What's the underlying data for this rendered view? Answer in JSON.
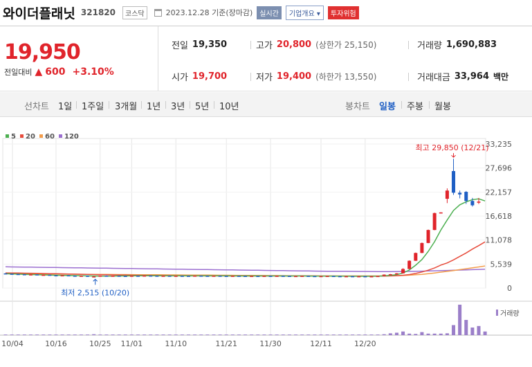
{
  "header": {
    "name": "와이더플래닛",
    "code": "321820",
    "market": "코스닥",
    "date": "2023.12.28 기준(장마감)",
    "live": "실시간",
    "company_info": "기업개요",
    "risk": "투자위험"
  },
  "quote": {
    "price": "19,950",
    "change_label": "전일대비",
    "change": "600",
    "change_pct": "+3.10%",
    "prev_close_label": "전일",
    "prev_close": "19,350",
    "high_label": "고가",
    "high": "20,800",
    "upper_limit": "(상한가 25,150)",
    "volume_label": "거래량",
    "volume": "1,690,883",
    "open_label": "시가",
    "open": "19,700",
    "low_label": "저가",
    "low": "19,400",
    "lower_limit": "(하한가 13,550)",
    "amount_label": "거래대금",
    "amount": "33,964",
    "amount_unit": "백만"
  },
  "toolbar": {
    "line_chart": "선차트",
    "periods": [
      "1일",
      "1주일",
      "3개월",
      "1년",
      "3년",
      "5년",
      "10년"
    ],
    "candle_chart": "봉차트",
    "candle_periods": [
      "일봉",
      "주봉",
      "월봉"
    ]
  },
  "colors": {
    "up": "#e0242b",
    "down": "#1f5fc4",
    "ma5": "#4caf50",
    "ma20": "#e74c3c",
    "ma60": "#f39c4a",
    "ma120": "#9b6fd0",
    "volume": "#9b7fc9"
  },
  "chart_data": {
    "type": "candlestick",
    "legend": [
      "5",
      "20",
      "60",
      "120"
    ],
    "x_tick_labels": [
      "10/04",
      "10/16",
      "10/25",
      "11/01",
      "11/10",
      "11/21",
      "11/30",
      "12/11",
      "12/20"
    ],
    "y_tick_labels": [
      "33,235",
      "27,696",
      "22,157",
      "16,618",
      "11,078",
      "5,539",
      "0"
    ],
    "ylim": [
      0,
      33235
    ],
    "max_label": "최고 29,850 (12/21)",
    "min_label": "최저 2,515 (10/20)",
    "volume_label": "거래량",
    "candles": [
      {
        "o": 3380,
        "h": 3420,
        "l": 3240,
        "c": 3260
      },
      {
        "o": 3300,
        "h": 3340,
        "l": 3220,
        "c": 3240
      },
      {
        "o": 3240,
        "h": 3280,
        "l": 3160,
        "c": 3190
      },
      {
        "o": 3190,
        "h": 3220,
        "l": 3080,
        "c": 3100
      },
      {
        "o": 3100,
        "h": 3160,
        "l": 3020,
        "c": 3150
      },
      {
        "o": 3150,
        "h": 3170,
        "l": 2980,
        "c": 2990
      },
      {
        "o": 2990,
        "h": 3080,
        "l": 2960,
        "c": 3060
      },
      {
        "o": 3060,
        "h": 3090,
        "l": 2930,
        "c": 2950
      },
      {
        "o": 2950,
        "h": 2990,
        "l": 2850,
        "c": 2880
      },
      {
        "o": 2880,
        "h": 2960,
        "l": 2850,
        "c": 2940
      },
      {
        "o": 2940,
        "h": 2970,
        "l": 2830,
        "c": 2850
      },
      {
        "o": 2850,
        "h": 2880,
        "l": 2750,
        "c": 2780
      },
      {
        "o": 2780,
        "h": 2850,
        "l": 2700,
        "c": 2830
      },
      {
        "o": 2830,
        "h": 2860,
        "l": 2600,
        "c": 2620
      },
      {
        "o": 2620,
        "h": 2700,
        "l": 2515,
        "c": 2680
      },
      {
        "o": 2680,
        "h": 2880,
        "l": 2660,
        "c": 2850
      },
      {
        "o": 2850,
        "h": 2900,
        "l": 2780,
        "c": 2800
      },
      {
        "o": 2800,
        "h": 2870,
        "l": 2760,
        "c": 2840
      },
      {
        "o": 2840,
        "h": 2880,
        "l": 2780,
        "c": 2800
      },
      {
        "o": 2800,
        "h": 2830,
        "l": 2720,
        "c": 2760
      },
      {
        "o": 2760,
        "h": 2860,
        "l": 2740,
        "c": 2840
      },
      {
        "o": 2840,
        "h": 2880,
        "l": 2790,
        "c": 2820
      },
      {
        "o": 2820,
        "h": 2900,
        "l": 2800,
        "c": 2880
      },
      {
        "o": 2880,
        "h": 2920,
        "l": 2830,
        "c": 2850
      },
      {
        "o": 2850,
        "h": 2880,
        "l": 2790,
        "c": 2810
      },
      {
        "o": 2810,
        "h": 2860,
        "l": 2780,
        "c": 2840
      },
      {
        "o": 2840,
        "h": 2870,
        "l": 2760,
        "c": 2780
      },
      {
        "o": 2780,
        "h": 2840,
        "l": 2750,
        "c": 2830
      },
      {
        "o": 2830,
        "h": 2870,
        "l": 2800,
        "c": 2820
      },
      {
        "o": 2820,
        "h": 2850,
        "l": 2760,
        "c": 2790
      },
      {
        "o": 2790,
        "h": 2880,
        "l": 2770,
        "c": 2860
      },
      {
        "o": 2860,
        "h": 2890,
        "l": 2810,
        "c": 2830
      },
      {
        "o": 2830,
        "h": 2860,
        "l": 2780,
        "c": 2800
      },
      {
        "o": 2800,
        "h": 2850,
        "l": 2780,
        "c": 2840
      },
      {
        "o": 2840,
        "h": 2860,
        "l": 2790,
        "c": 2810
      },
      {
        "o": 2810,
        "h": 2830,
        "l": 2760,
        "c": 2780
      },
      {
        "o": 2780,
        "h": 2830,
        "l": 2750,
        "c": 2820
      },
      {
        "o": 2820,
        "h": 2860,
        "l": 2790,
        "c": 2800
      },
      {
        "o": 2800,
        "h": 2830,
        "l": 2730,
        "c": 2750
      },
      {
        "o": 2750,
        "h": 2800,
        "l": 2720,
        "c": 2790
      },
      {
        "o": 2790,
        "h": 2820,
        "l": 2760,
        "c": 2780
      },
      {
        "o": 2780,
        "h": 2820,
        "l": 2740,
        "c": 2810
      },
      {
        "o": 2810,
        "h": 2840,
        "l": 2770,
        "c": 2790
      },
      {
        "o": 2790,
        "h": 2830,
        "l": 2760,
        "c": 2820
      },
      {
        "o": 2820,
        "h": 2850,
        "l": 2780,
        "c": 2800
      },
      {
        "o": 2800,
        "h": 2830,
        "l": 2740,
        "c": 2760
      },
      {
        "o": 2760,
        "h": 2800,
        "l": 2720,
        "c": 2780
      },
      {
        "o": 2780,
        "h": 2830,
        "l": 2750,
        "c": 2810
      },
      {
        "o": 2810,
        "h": 2840,
        "l": 2760,
        "c": 2770
      },
      {
        "o": 2770,
        "h": 2800,
        "l": 2710,
        "c": 2730
      },
      {
        "o": 2730,
        "h": 2780,
        "l": 2700,
        "c": 2760
      },
      {
        "o": 2760,
        "h": 2800,
        "l": 2730,
        "c": 2790
      },
      {
        "o": 2790,
        "h": 2820,
        "l": 2740,
        "c": 2750
      },
      {
        "o": 2750,
        "h": 2780,
        "l": 2700,
        "c": 2720
      },
      {
        "o": 2720,
        "h": 2760,
        "l": 2680,
        "c": 2740
      },
      {
        "o": 2740,
        "h": 2770,
        "l": 2700,
        "c": 2710
      },
      {
        "o": 2710,
        "h": 2750,
        "l": 2670,
        "c": 2730
      },
      {
        "o": 2730,
        "h": 2760,
        "l": 2690,
        "c": 2700
      },
      {
        "o": 2700,
        "h": 2740,
        "l": 2660,
        "c": 2720
      },
      {
        "o": 2720,
        "h": 2790,
        "l": 2700,
        "c": 2780
      },
      {
        "o": 2780,
        "h": 3150,
        "l": 2760,
        "c": 3100
      },
      {
        "o": 3100,
        "h": 3250,
        "l": 3050,
        "c": 3200
      },
      {
        "o": 3200,
        "h": 3450,
        "l": 3150,
        "c": 3400
      },
      {
        "o": 3400,
        "h": 4600,
        "l": 3350,
        "c": 4400
      },
      {
        "o": 4400,
        "h": 6400,
        "l": 4350,
        "c": 6300
      },
      {
        "o": 6300,
        "h": 8200,
        "l": 6250,
        "c": 8100
      },
      {
        "o": 8100,
        "h": 10500,
        "l": 8050,
        "c": 10400
      },
      {
        "o": 10400,
        "h": 13500,
        "l": 10350,
        "c": 13400
      },
      {
        "o": 13400,
        "h": 17400,
        "l": 13350,
        "c": 17300
      },
      {
        "o": 17300,
        "h": 17500,
        "l": 17200,
        "c": 17450
      },
      {
        "o": 20600,
        "h": 23000,
        "l": 19600,
        "c": 22500
      },
      {
        "o": 27000,
        "h": 29850,
        "l": 21500,
        "c": 22000
      },
      {
        "o": 22000,
        "h": 22500,
        "l": 20700,
        "c": 21600
      },
      {
        "o": 22200,
        "h": 22400,
        "l": 19400,
        "c": 20100
      },
      {
        "o": 20100,
        "h": 20800,
        "l": 18800,
        "c": 19100
      },
      {
        "o": 19700,
        "h": 20800,
        "l": 19400,
        "c": 19950
      }
    ],
    "ma5": [
      3300,
      3260,
      3210,
      3160,
      3110,
      3070,
      3030,
      2990,
      2960,
      2940,
      2900,
      2870,
      2840,
      2810,
      2780,
      2760,
      2760,
      2770,
      2790,
      2800,
      2810,
      2820,
      2830,
      2840,
      2830,
      2820,
      2810,
      2810,
      2810,
      2810,
      2820,
      2820,
      2820,
      2820,
      2820,
      2810,
      2800,
      2800,
      2790,
      2790,
      2790,
      2790,
      2790,
      2800,
      2790,
      2780,
      2790,
      2790,
      2780,
      2770,
      2760,
      2760,
      2750,
      2740,
      2730,
      2720,
      2720,
      2720,
      2720,
      2730,
      2820,
      2940,
      3100,
      3460,
      4170,
      5280,
      6580,
      8460,
      10700,
      13400,
      15700,
      17900,
      19200,
      19900,
      20400,
      20600,
      20100
    ],
    "ma20": [
      3500,
      3480,
      3460,
      3440,
      3420,
      3390,
      3360,
      3330,
      3300,
      3270,
      3240,
      3210,
      3180,
      3150,
      3120,
      3090,
      3060,
      3030,
      3000,
      2980,
      2960,
      2940,
      2920,
      2900,
      2880,
      2870,
      2860,
      2850,
      2840,
      2830,
      2820,
      2820,
      2810,
      2810,
      2810,
      2810,
      2800,
      2800,
      2800,
      2800,
      2800,
      2800,
      2800,
      2800,
      2800,
      2800,
      2790,
      2790,
      2790,
      2790,
      2780,
      2780,
      2780,
      2770,
      2770,
      2760,
      2760,
      2760,
      2750,
      2750,
      2770,
      2800,
      2850,
      2950,
      3120,
      3370,
      3700,
      4120,
      4650,
      5300,
      5800,
      6500,
      7300,
      8100,
      9000,
      9800,
      10650
    ],
    "ma60": [
      3300,
      3290,
      3280,
      3270,
      3260,
      3250,
      3240,
      3230,
      3220,
      3210,
      3200,
      3190,
      3180,
      3170,
      3160,
      3150,
      3140,
      3130,
      3120,
      3110,
      3100,
      3090,
      3080,
      3070,
      3060,
      3050,
      3040,
      3030,
      3020,
      3010,
      3000,
      2990,
      2980,
      2970,
      2960,
      2950,
      2940,
      2930,
      2920,
      2910,
      2900,
      2890,
      2880,
      2870,
      2860,
      2850,
      2840,
      2830,
      2820,
      2810,
      2800,
      2800,
      2800,
      2800,
      2800,
      2800,
      2800,
      2800,
      2800,
      2800,
      2810,
      2830,
      2860,
      2900,
      2970,
      3060,
      3170,
      3310,
      3480,
      3670,
      3850,
      4050,
      4250,
      4460,
      4670,
      4880,
      5100
    ],
    "ma120": [
      4900,
      4880,
      4860,
      4840,
      4820,
      4800,
      4780,
      4760,
      4740,
      4720,
      4700,
      4680,
      4660,
      4640,
      4620,
      4600,
      4580,
      4560,
      4540,
      4520,
      4500,
      4480,
      4460,
      4440,
      4420,
      4400,
      4380,
      4360,
      4340,
      4320,
      4300,
      4280,
      4260,
      4240,
      4220,
      4200,
      4180,
      4160,
      4140,
      4120,
      4100,
      4080,
      4060,
      4040,
      4020,
      4000,
      3980,
      3960,
      3940,
      3920,
      3900,
      3890,
      3880,
      3870,
      3860,
      3850,
      3840,
      3830,
      3820,
      3810,
      3810,
      3810,
      3820,
      3830,
      3850,
      3870,
      3900,
      3940,
      3980,
      4020,
      4060,
      4100,
      4150,
      4200,
      4250,
      4300,
      4350
    ],
    "volume": [
      0.02,
      0.02,
      0.02,
      0.02,
      0.02,
      0.02,
      0.02,
      0.02,
      0.02,
      0.02,
      0.02,
      0.02,
      0.02,
      0.02,
      0.03,
      0.02,
      0.02,
      0.02,
      0.02,
      0.02,
      0.02,
      0.02,
      0.02,
      0.02,
      0.02,
      0.02,
      0.02,
      0.02,
      0.02,
      0.02,
      0.02,
      0.02,
      0.02,
      0.02,
      0.02,
      0.02,
      0.02,
      0.02,
      0.02,
      0.02,
      0.02,
      0.02,
      0.02,
      0.02,
      0.02,
      0.02,
      0.02,
      0.02,
      0.02,
      0.02,
      0.02,
      0.02,
      0.02,
      0.02,
      0.02,
      0.02,
      0.02,
      0.02,
      0.02,
      0.02,
      0.03,
      0.06,
      0.08,
      0.12,
      0.05,
      0.04,
      0.1,
      0.05,
      0.05,
      0.05,
      0.06,
      0.33,
      1.0,
      0.5,
      0.25,
      0.3,
      0.12
    ]
  }
}
